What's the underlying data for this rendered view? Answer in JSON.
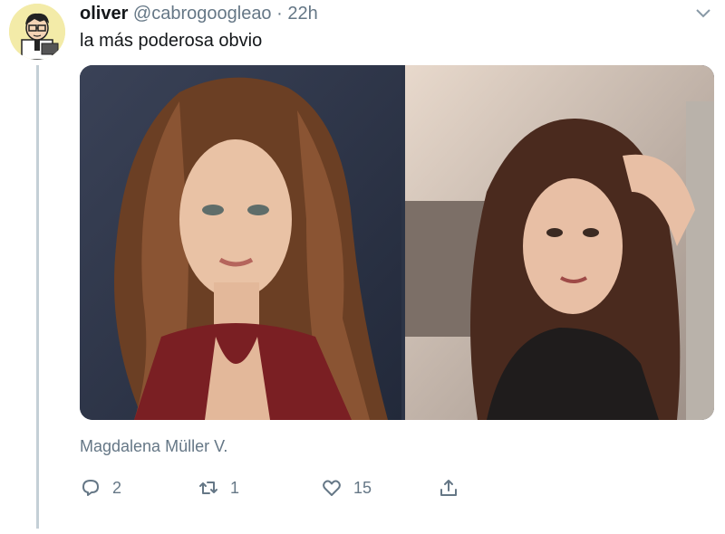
{
  "tweet": {
    "name": "oliver",
    "handle": "@cabrogoogleao",
    "separator": "·",
    "time": "22h",
    "text": "la más poderosa obvio",
    "caption": "Magdalena Müller V.",
    "replies": "2",
    "retweets": "1",
    "likes": "15"
  },
  "icons": {
    "avatar": "cartoon-avatar",
    "menu": "chevron-down-icon",
    "reply": "reply-icon",
    "retweet": "retweet-icon",
    "like": "heart-icon",
    "share": "share-icon"
  },
  "colors": {
    "secondary_text": "#657786",
    "primary_text": "#14171a",
    "thread_line": "#c4cfd6"
  }
}
